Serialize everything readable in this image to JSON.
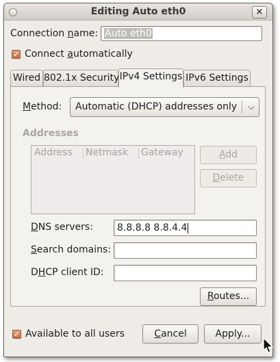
{
  "window": {
    "title": "Editing Auto eth0",
    "close_glyph": "×"
  },
  "connection_name": {
    "label_pre": "Connection ",
    "label_u": "n",
    "label_post": "ame:",
    "value": "Auto eth0"
  },
  "connect_automatically": {
    "label_pre": "Connect ",
    "label_u": "a",
    "label_post": "utomatically",
    "checked": true,
    "check_glyph": "✓"
  },
  "tabs": [
    {
      "label": "Wired",
      "active": false
    },
    {
      "label": "802.1x Security",
      "active": false
    },
    {
      "label": "IPv4 Settings",
      "active": true
    },
    {
      "label": "IPv6 Settings",
      "active": false
    }
  ],
  "method": {
    "label_pre": "",
    "label_u": "M",
    "label_post": "ethod:",
    "selected": "Automatic (DHCP) addresses only",
    "arrow_glyph": "⌵"
  },
  "addresses": {
    "section_label": "Addresses",
    "columns": [
      "Address",
      "Netmask",
      "Gateway"
    ],
    "rows": [],
    "add_pre": "",
    "add_u": "A",
    "add_post": "dd",
    "delete_pre": "",
    "delete_u": "D",
    "delete_post": "elete"
  },
  "dns_servers": {
    "label_pre": "",
    "label_u": "D",
    "label_post": "NS servers:",
    "value": "8.8.8.8 8.8.4.4"
  },
  "search_domains": {
    "label_pre": "",
    "label_u": "S",
    "label_post": "earch domains:",
    "value": ""
  },
  "dhcp_client_id": {
    "label_pre": "D",
    "label_u": "H",
    "label_post": "CP client ID:",
    "value": ""
  },
  "routes_button": {
    "label_pre": "",
    "label_u": "R",
    "label_post": "outes..."
  },
  "available_to_all_users": {
    "label": "Available to all users",
    "checked": true,
    "check_glyph": "✓"
  },
  "cancel_button": {
    "label_pre": "",
    "label_u": "C",
    "label_post": "ancel"
  },
  "apply_button": {
    "label": "Apply..."
  },
  "colors": {
    "accent": "#d1774a",
    "window_bg": "#efebe7",
    "disabled_text": "#a9a59f"
  }
}
